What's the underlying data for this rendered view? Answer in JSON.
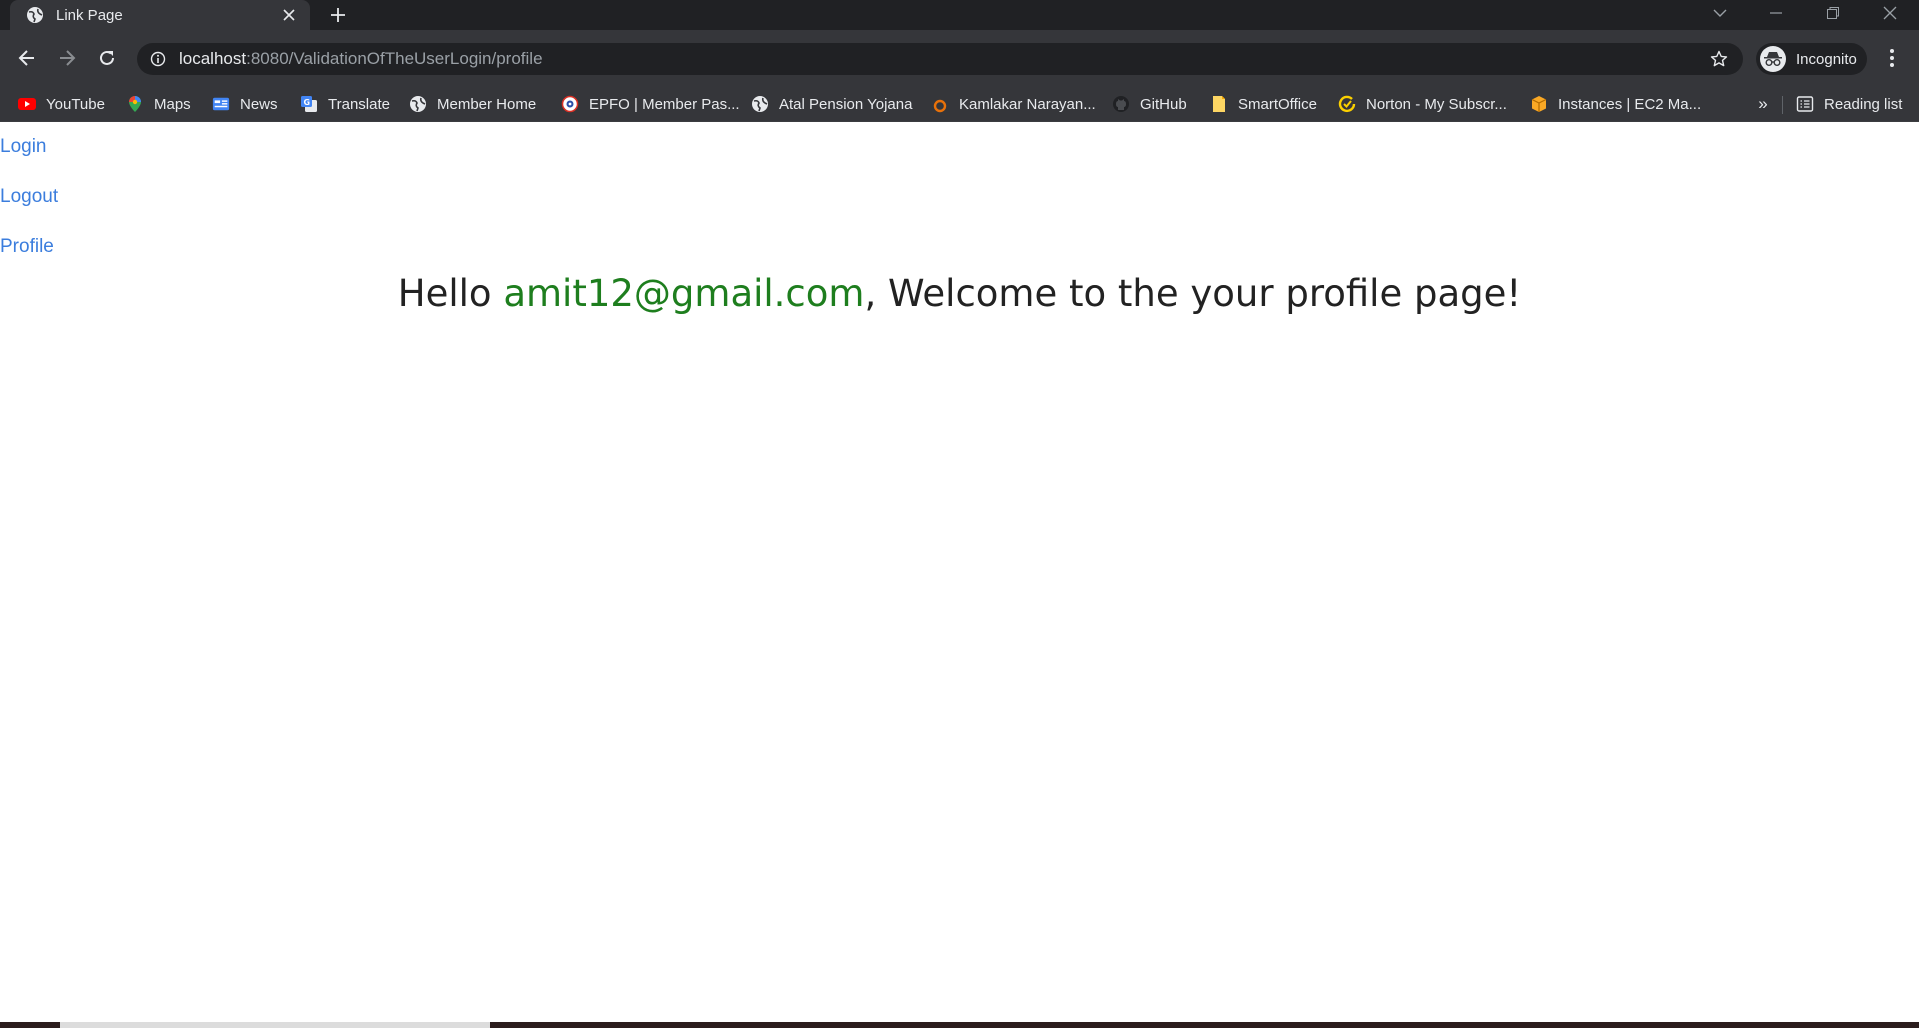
{
  "tab": {
    "title": "Link Page"
  },
  "omnibox": {
    "host": "localhost",
    "path": ":8080/ValidationOfTheUserLogin/profile"
  },
  "profile_chip": {
    "label": "Incognito"
  },
  "bookmarks": [
    {
      "label": "YouTube",
      "icon": "youtube-icon"
    },
    {
      "label": "Maps",
      "icon": "maps-pin-icon"
    },
    {
      "label": "News",
      "icon": "google-news-icon"
    },
    {
      "label": "Translate",
      "icon": "google-translate-icon"
    },
    {
      "label": "Member Home",
      "icon": "globe-icon"
    },
    {
      "label": "EPFO | Member Pas...",
      "icon": "epfo-emblem-icon"
    },
    {
      "label": "Atal Pension Yojana",
      "icon": "globe-icon"
    },
    {
      "label": "Kamlakar Narayan...",
      "icon": "orange-ring-icon"
    },
    {
      "label": "GitHub",
      "icon": "github-icon"
    },
    {
      "label": "SmartOffice",
      "icon": "bookmark-note-icon"
    },
    {
      "label": "Norton - My Subscr...",
      "icon": "norton-icon"
    },
    {
      "label": "Instances | EC2 Ma...",
      "icon": "aws-box-icon"
    }
  ],
  "bookmarks_more": "»",
  "reading_list": {
    "label": "Reading list"
  },
  "page": {
    "links": {
      "login": "Login",
      "logout": "Logout",
      "profile": "Profile"
    },
    "greeting": {
      "prefix": "Hello ",
      "email": "amit12@gmail.com",
      "suffix": ", Welcome to the your profile page!"
    }
  },
  "colors": {
    "chrome_dark": "#202124",
    "chrome_toolbar": "#35363a",
    "link_blue": "#3b7ddd",
    "email_green": "#1e7e1e",
    "text_dark": "#222222"
  }
}
